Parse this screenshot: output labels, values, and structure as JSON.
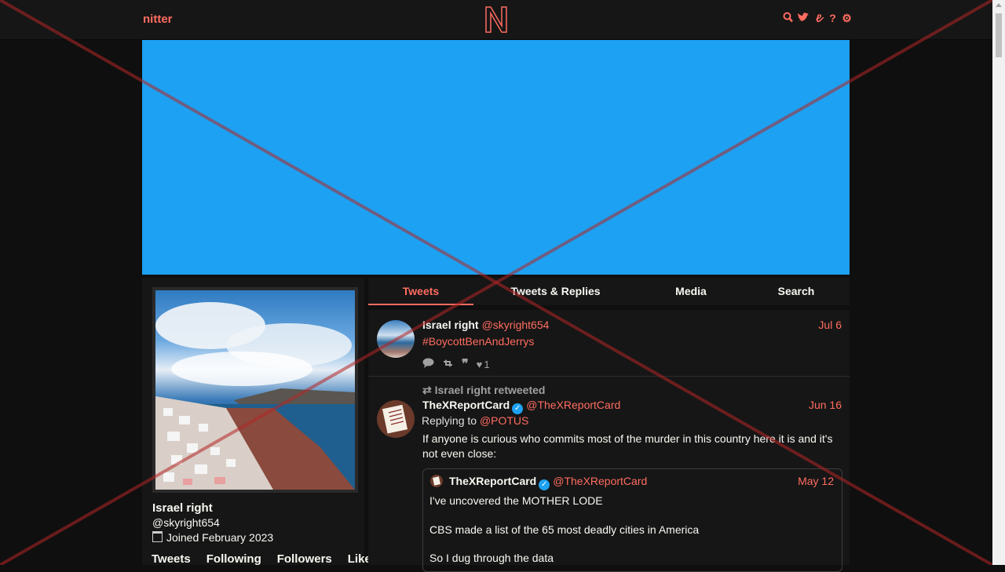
{
  "nav": {
    "brand": "nitter",
    "icons": [
      "search-icon",
      "twitter-icon",
      "rss-icon",
      "help-icon",
      "settings-icon"
    ]
  },
  "profile": {
    "name": "Israel right",
    "handle": "@skyright654",
    "joined": "Joined February 2023",
    "stats": [
      "Tweets",
      "Following",
      "Followers",
      "Likes"
    ]
  },
  "tabs": [
    "Tweets",
    "Tweets & Replies",
    "Media",
    "Search"
  ],
  "tweets": [
    {
      "name": "Israel right",
      "handle": "@skyright654",
      "date": "Jul 6",
      "text": "#BoycottBenAndJerrys",
      "likes": "1"
    },
    {
      "retweet_label": "Israel right retweeted",
      "name": "TheXReportCard",
      "handle": "@TheXReportCard",
      "date": "Jun 16",
      "replying_prefix": "Replying to",
      "replying_to": "@POTUS",
      "text_line1": "If anyone is curious who commits most of the murder in this country here it is and it's",
      "text_line2": "not even close:",
      "quote": {
        "name": "TheXReportCard",
        "handle": "@TheXReportCard",
        "date": "May 12",
        "line1": "I've uncovered the MOTHER LODE",
        "line2": "CBS made a list of the 65 most deadly cities in America",
        "line3": "So I dug through the data"
      }
    }
  ],
  "colors": {
    "accent": "#ff6c60",
    "banner": "#1da1f2",
    "background": "#0f0f0f",
    "panel": "#161616"
  }
}
